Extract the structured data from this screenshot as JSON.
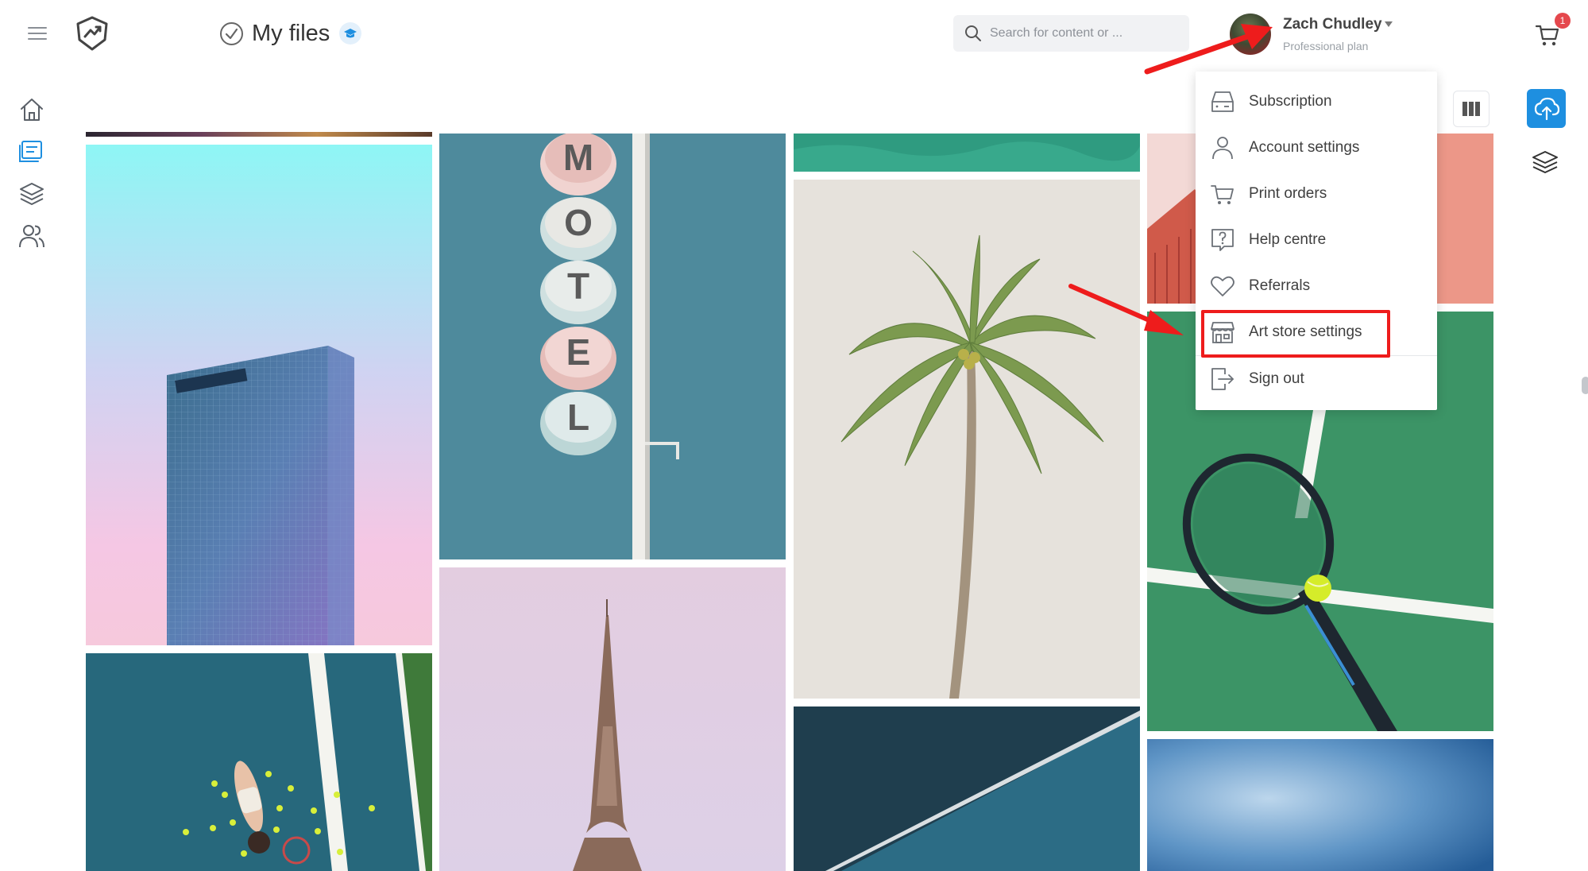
{
  "header": {
    "title": "My files",
    "search_placeholder": "Search for content or ..."
  },
  "user": {
    "name": "Zach Chudley",
    "plan": "Professional plan"
  },
  "cart": {
    "badge_count": "1"
  },
  "user_menu": {
    "items": [
      {
        "label": "Subscription",
        "icon": "subscription-icon"
      },
      {
        "label": "Account settings",
        "icon": "user-icon"
      },
      {
        "label": "Print orders",
        "icon": "cart-icon"
      },
      {
        "label": "Help centre",
        "icon": "help-icon"
      },
      {
        "label": "Referrals",
        "icon": "heart-icon"
      },
      {
        "label": "Art store settings",
        "icon": "store-icon"
      },
      {
        "label": "Sign out",
        "icon": "sign-out-icon"
      }
    ],
    "highlighted_item": "Art store settings"
  },
  "left_nav": {
    "items": [
      "home-icon",
      "my-files-icon",
      "layers-icon",
      "users-icon"
    ],
    "active": "my-files-icon"
  },
  "gallery": {
    "images": [
      "glass-tower-pastel-sky",
      "motel-sign",
      "aerial-turquoise-water",
      "palm-tree",
      "coral-building",
      "tennis-racket-green-court",
      "tennis-player-blue-court",
      "eiffel-tower-pink-sky",
      "teal-court-corner",
      "blue-sky-gradient"
    ]
  },
  "colors": {
    "accent": "#1e8fe0",
    "highlight_red": "#ee1c1c",
    "badge_red": "#e5484d"
  }
}
